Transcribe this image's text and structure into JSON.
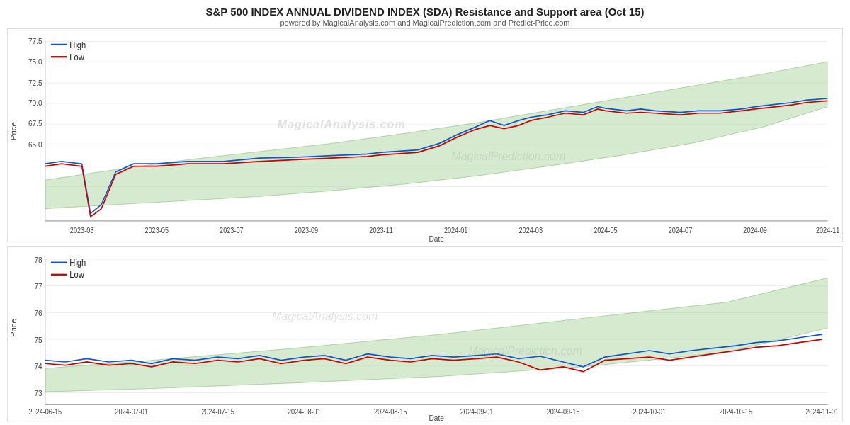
{
  "header": {
    "title": "S&P 500 INDEX ANNUAL DIVIDEND INDEX (SDA) Resistance and Support area (Oct 15)",
    "subtitle": "powered by MagicalAnalysis.com and MagicalPrediction.com and Predict-Price.com"
  },
  "chart1": {
    "legend": {
      "high_label": "High",
      "low_label": "Low"
    },
    "y_axis_label": "Price",
    "x_axis_label": "Date",
    "y_ticks": [
      "77.5",
      "75.0",
      "72.5",
      "70.0",
      "67.5",
      "65.0"
    ],
    "x_ticks": [
      "2023-03",
      "2023-05",
      "2023-07",
      "2023-09",
      "2023-11",
      "2024-01",
      "2024-03",
      "2024-05",
      "2024-07",
      "2024-09",
      "2024-11"
    ],
    "watermark1": "MagicalAnalysis.com",
    "watermark2": "MagicalPrediction.com"
  },
  "chart2": {
    "legend": {
      "high_label": "High",
      "low_label": "Low"
    },
    "y_axis_label": "Price",
    "x_axis_label": "Date",
    "y_ticks": [
      "78",
      "77",
      "76",
      "75",
      "74",
      "73"
    ],
    "x_ticks": [
      "2024-06-15",
      "2024-07-01",
      "2024-07-15",
      "2024-08-01",
      "2024-08-15",
      "2024-09-01",
      "2024-09-15",
      "2024-10-01",
      "2024-10-15",
      "2024-11-01"
    ],
    "watermark1": "MagicalAnalysis.com",
    "watermark2": "MagicalPrediction.com"
  },
  "colors": {
    "high_line": "#1155cc",
    "low_line": "#cc0000",
    "band_fill": "rgba(144,200,144,0.45)",
    "band_stroke": "rgba(100,170,100,0.6)",
    "grid": "#e8e8e8",
    "axis_text": "#444"
  }
}
